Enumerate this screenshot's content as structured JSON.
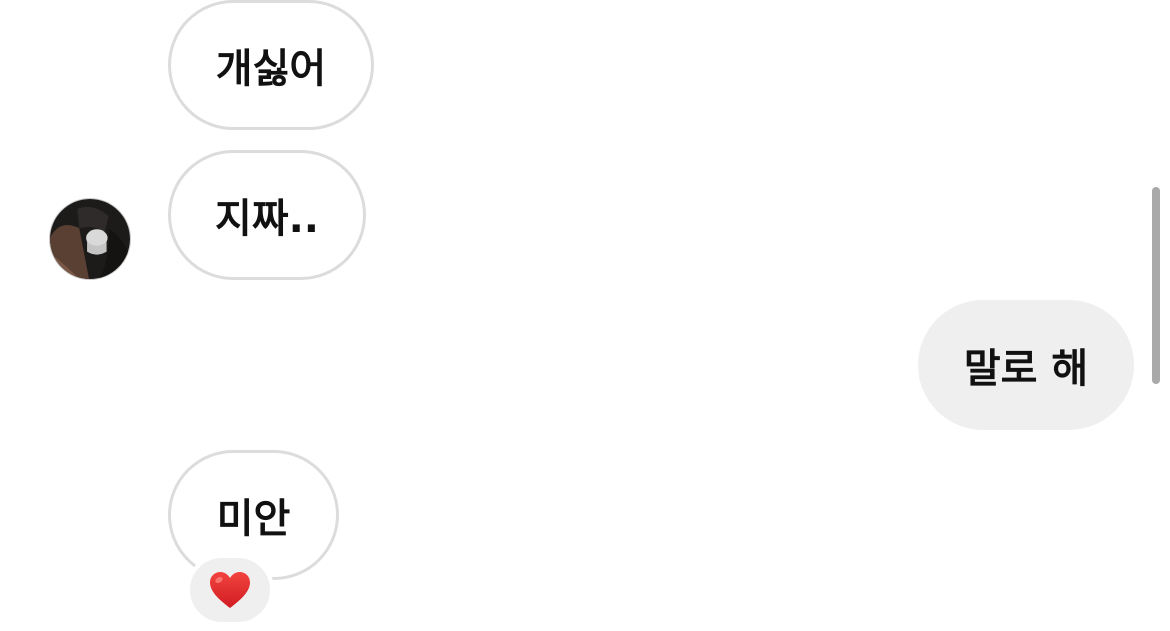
{
  "messages": [
    {
      "text": "개싫어",
      "direction": "incoming"
    },
    {
      "text": "지짜..",
      "direction": "incoming"
    },
    {
      "text": "말로 해",
      "direction": "outgoing"
    },
    {
      "text": "미안",
      "direction": "incoming"
    }
  ],
  "reaction": {
    "icon": "heart-icon",
    "color": "#e8262a"
  },
  "colors": {
    "incoming_border": "#dcdcdc",
    "outgoing_background": "#efefef",
    "text": "#111111"
  },
  "avatar": {
    "icon": "contact-avatar"
  }
}
